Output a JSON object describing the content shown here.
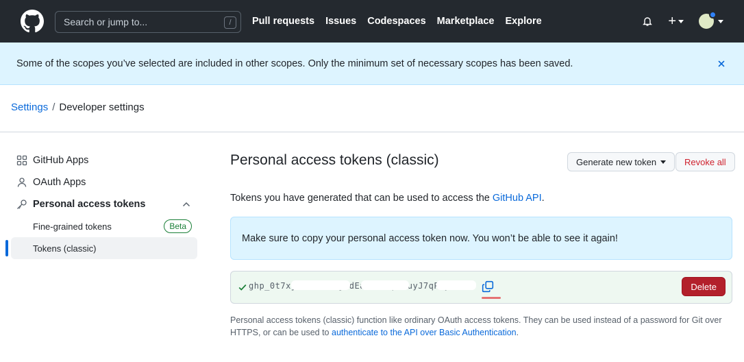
{
  "header": {
    "search_placeholder": "Search or jump to...",
    "search_shortcut": "/",
    "nav": [
      "Pull requests",
      "Issues",
      "Codespaces",
      "Marketplace",
      "Explore"
    ],
    "plus_label": "+"
  },
  "flash": {
    "message": "Some of the scopes you’ve selected are included in other scopes. Only the minimum set of necessary scopes has been saved."
  },
  "breadcrumb": {
    "root": "Settings",
    "separator": "/",
    "current": "Developer settings"
  },
  "sidebar": {
    "github_apps": "GitHub Apps",
    "oauth_apps": "OAuth Apps",
    "pat": "Personal access tokens",
    "fine_grained": "Fine-grained tokens",
    "beta": "Beta",
    "classic": "Tokens (classic)"
  },
  "main": {
    "title": "Personal access tokens (classic)",
    "generate_label": "Generate new token",
    "revoke_label": "Revoke all",
    "desc_prefix": "Tokens you have generated that can be used to access the ",
    "desc_link": "GitHub API",
    "desc_suffix": ".",
    "notice": "Make sure to copy your personal access token now. You won’t be able to see it again!",
    "token_value": "ghp_0t7xjkTuiPbJ6jddEaJc6x2pZ7uyJ7qPkyuXD",
    "delete_label": "Delete",
    "footnote_text": "Personal access tokens (classic) function like ordinary OAuth access tokens. They can be used instead of a password for Git over HTTPS, or can be used to ",
    "footnote_link": "authenticate to the API over Basic Authentication",
    "footnote_end": "."
  },
  "colors": {
    "header_bg": "#24292f",
    "accent": "#0969da",
    "flash_bg": "#ddf4ff",
    "danger": "#b3202b",
    "success": "#1a7f37"
  }
}
